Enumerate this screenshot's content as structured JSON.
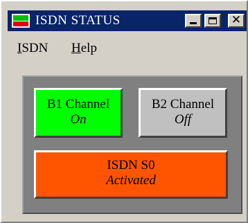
{
  "window": {
    "title": "ISDN STATUS"
  },
  "menu": {
    "isdn": {
      "accel": "I",
      "rest": "SDN"
    },
    "help": {
      "accel": "H",
      "rest": "elp"
    }
  },
  "indicators": {
    "b1": {
      "name": "B1 Channel",
      "state": "On",
      "color": "#00ff00"
    },
    "b2": {
      "name": "B2 Channel",
      "state": "Off",
      "color": "#c0c0c0"
    },
    "s0": {
      "name": "ISDN S0",
      "state": "Activated",
      "color": "#ff5500"
    }
  },
  "colors": {
    "titlebar": "#0a246a",
    "window": "#d4d0c8",
    "panel": "#808080"
  }
}
